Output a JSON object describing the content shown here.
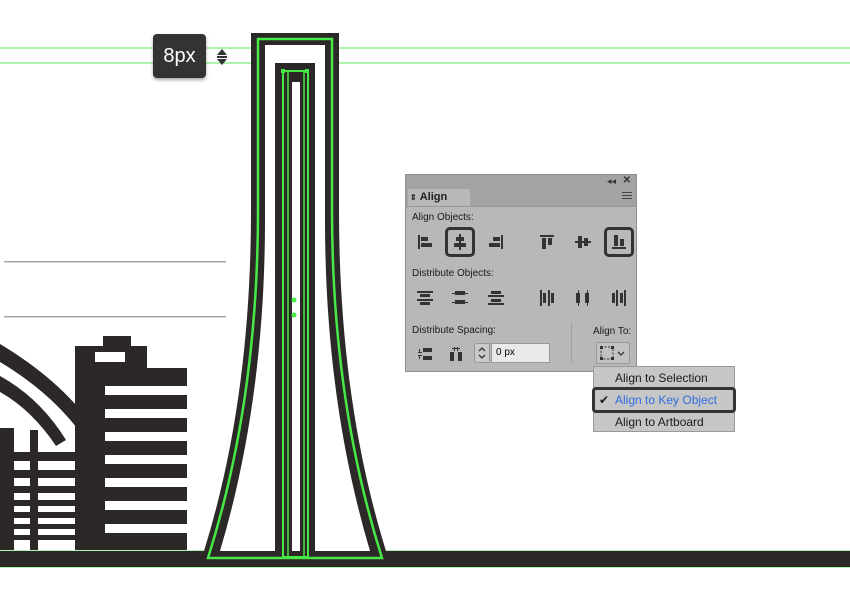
{
  "tooltip": {
    "text": "8px"
  },
  "panel": {
    "tab": "Align",
    "align_objects_label": "Align Objects:",
    "distribute_objects_label": "Distribute Objects:",
    "distribute_spacing_label": "Distribute Spacing:",
    "align_to_label": "Align To:",
    "spacing_value": "0 px",
    "align_objects_buttons": [
      {
        "name": "horizontal-align-left",
        "icon": "align-left-icon",
        "selected": false
      },
      {
        "name": "horizontal-align-center",
        "icon": "align-hcenter-icon",
        "selected": true
      },
      {
        "name": "horizontal-align-right",
        "icon": "align-right-icon",
        "selected": false
      },
      {
        "name": "vertical-align-top",
        "icon": "align-top-icon",
        "selected": false
      },
      {
        "name": "vertical-align-center",
        "icon": "align-vcenter-icon",
        "selected": false
      },
      {
        "name": "vertical-align-bottom",
        "icon": "align-bottom-icon",
        "selected": true
      }
    ],
    "distribute_objects_buttons": [
      {
        "name": "vertical-distribute-top",
        "icon": "distribute-top-icon"
      },
      {
        "name": "vertical-distribute-center",
        "icon": "distribute-vcenter-icon"
      },
      {
        "name": "vertical-distribute-bottom",
        "icon": "distribute-bottom-icon"
      },
      {
        "name": "horizontal-distribute-left",
        "icon": "distribute-left-icon"
      },
      {
        "name": "horizontal-distribute-center",
        "icon": "distribute-hcenter-icon"
      },
      {
        "name": "horizontal-distribute-right",
        "icon": "distribute-right-icon"
      }
    ]
  },
  "dropdown": {
    "items": [
      {
        "label": "Align to Selection",
        "checked": false
      },
      {
        "label": "Align to Key Object",
        "checked": true
      },
      {
        "label": "Align to Artboard",
        "checked": false
      }
    ]
  },
  "colors": {
    "guide": "#5ee85e",
    "selection": "#46e846",
    "art_dark": "#2d2828",
    "panel_bg": "#b8b8b8",
    "active_text": "#2f6de0"
  }
}
